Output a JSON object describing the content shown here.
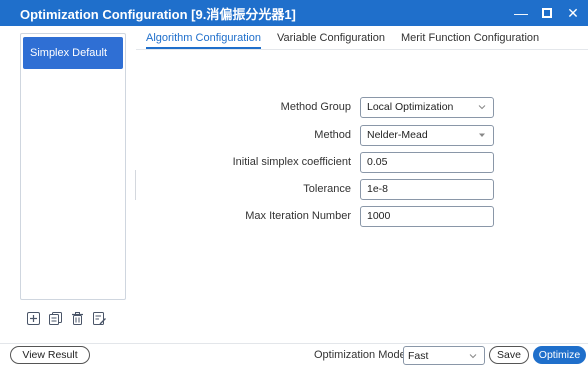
{
  "window": {
    "title": "Optimization Configuration [9.消偏振分光器1]",
    "minimize_glyph": "—",
    "close_glyph": "✕"
  },
  "sidebar": {
    "items": [
      {
        "label": "Simplex Default",
        "selected": true
      }
    ],
    "toolbar_icons": [
      "add-icon",
      "copy-icon",
      "delete-icon",
      "edit-icon"
    ]
  },
  "tabs": [
    {
      "label": "Algorithm Configuration",
      "active": true
    },
    {
      "label": "Variable Configuration",
      "active": false
    },
    {
      "label": "Merit Function Configuration",
      "active": false
    }
  ],
  "form": {
    "method_group": {
      "label": "Method Group",
      "value": "Local Optimization"
    },
    "method": {
      "label": "Method",
      "value": "Nelder-Mead"
    },
    "initial_simplex_coefficient": {
      "label": "Initial simplex coefficient",
      "value": "0.05"
    },
    "tolerance": {
      "label": "Tolerance",
      "value": "1e-8"
    },
    "max_iteration_number": {
      "label": "Max Iteration Number",
      "value": "1000"
    }
  },
  "bottom": {
    "view_result_label": "View Result",
    "optimization_mode_label": "Optimization Mode:",
    "optimization_mode_value": "Fast",
    "save_label": "Save",
    "optimize_label": "Optimize"
  },
  "colors": {
    "accent": "#1f6fcb",
    "selected_item": "#2f6fd4"
  }
}
